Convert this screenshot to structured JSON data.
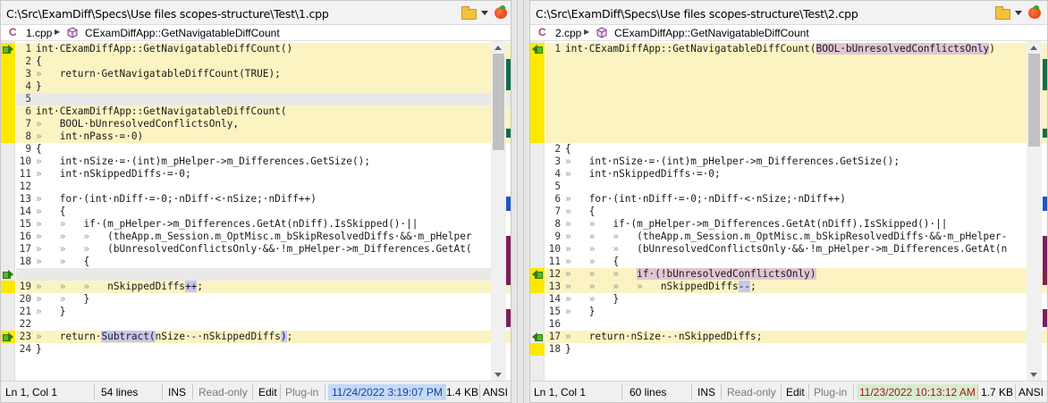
{
  "colors": {
    "changed_line_bg": "#fbf3c2",
    "deleted_gap_bg": "#e9e9e9",
    "added_token_bg": "#c9c9f2",
    "changed_token_bg": "#e4c6d6",
    "change_marker_yellow": "#ffe800",
    "nav_arrow_green": "#58b72e",
    "date_left_bg": "#c3d9f7",
    "date_right_bg": "#d8eccf",
    "date_right_text": "#a01818"
  },
  "left": {
    "path": "C:\\Src\\ExamDiff\\Specs\\Use files scopes-structure\\Test\\1.cpp",
    "breadcrumb": {
      "lang_icon": "C",
      "file": "1.cpp",
      "sep": "▶",
      "function": "CExamDiffApp::GetNavigatableDiffCount"
    },
    "lines": [
      {
        "n": "1",
        "bg": "#fbf3c2",
        "arrow": "right",
        "segs": [
          {
            "t": "int·CExamDiffApp::GetNavigatableDiffCount()"
          }
        ]
      },
      {
        "n": "2",
        "bg": "#fbf3c2",
        "segs": [
          {
            "t": "{"
          }
        ]
      },
      {
        "n": "3",
        "bg": "#fbf3c2",
        "segs": [
          {
            "t": "»   ",
            "c": "ws"
          },
          {
            "t": "return·GetNavigatableDiffCount(TRUE);"
          }
        ]
      },
      {
        "n": "4",
        "bg": "#fbf3c2",
        "segs": [
          {
            "t": "}"
          }
        ]
      },
      {
        "n": "5",
        "bg": "#e9e9e9",
        "segs": [
          {
            "t": ""
          }
        ]
      },
      {
        "n": "6",
        "bg": "#fbf3c2",
        "segs": [
          {
            "t": "int·CExamDiffApp::GetNavigatableDiffCount("
          }
        ]
      },
      {
        "n": "7",
        "bg": "#fbf3c2",
        "segs": [
          {
            "t": "»   ",
            "c": "ws"
          },
          {
            "t": "BOOL·bUnresolvedConflictsOnly,"
          }
        ]
      },
      {
        "n": "8",
        "bg": "#fbf3c2",
        "segs": [
          {
            "t": "»   ",
            "c": "ws"
          },
          {
            "t": "int·nPass·=·0)"
          }
        ]
      },
      {
        "n": "9",
        "bg": "#ffffff",
        "segs": [
          {
            "t": "{"
          }
        ]
      },
      {
        "n": "10",
        "bg": "#ffffff",
        "segs": [
          {
            "t": "»   ",
            "c": "ws"
          },
          {
            "t": "int·nSize·=·(int)m_pHelper->m_Differences.GetSize();"
          }
        ]
      },
      {
        "n": "11",
        "bg": "#ffffff",
        "segs": [
          {
            "t": "»   ",
            "c": "ws"
          },
          {
            "t": "int·nSkippedDiffs·=·0;"
          }
        ]
      },
      {
        "n": "12",
        "bg": "#ffffff",
        "segs": [
          {
            "t": ""
          }
        ]
      },
      {
        "n": "13",
        "bg": "#ffffff",
        "segs": [
          {
            "t": "»   ",
            "c": "ws"
          },
          {
            "t": "for·(int·nDiff·=·0;·nDiff·<·nSize;·nDiff++)"
          }
        ]
      },
      {
        "n": "14",
        "bg": "#ffffff",
        "segs": [
          {
            "t": "»   ",
            "c": "ws"
          },
          {
            "t": "{"
          }
        ]
      },
      {
        "n": "15",
        "bg": "#ffffff",
        "segs": [
          {
            "t": "»   »   ",
            "c": "ws"
          },
          {
            "t": "if·(m_pHelper->m_Differences.GetAt(nDiff).IsSkipped()·||"
          }
        ]
      },
      {
        "n": "16",
        "bg": "#ffffff",
        "segs": [
          {
            "t": "»   »   »   ",
            "c": "ws"
          },
          {
            "t": "(theApp.m_Session.m_OptMisc.m_bSkipResolvedDiffs·&&·m_pHelper"
          }
        ]
      },
      {
        "n": "17",
        "bg": "#ffffff",
        "segs": [
          {
            "t": "»   »   »   ",
            "c": "ws"
          },
          {
            "t": "(bUnresolvedConflictsOnly·&&·!m_pHelper->m_Differences.GetAt("
          }
        ]
      },
      {
        "n": "18",
        "bg": "#ffffff",
        "segs": [
          {
            "t": "»   »   ",
            "c": "ws"
          },
          {
            "t": "{"
          }
        ]
      },
      {
        "n": "",
        "bg": "#e9e9e9",
        "arrow": "right",
        "segs": [
          {
            "t": ""
          }
        ]
      },
      {
        "n": "19",
        "bg": "#fbf3c2",
        "segs": [
          {
            "t": "»   »   »   ",
            "c": "ws"
          },
          {
            "t": "nSkippedDiffs"
          },
          {
            "t": "++",
            "c": "add"
          },
          {
            "t": ";"
          }
        ]
      },
      {
        "n": "20",
        "bg": "#ffffff",
        "segs": [
          {
            "t": "»   »   ",
            "c": "ws"
          },
          {
            "t": "}"
          }
        ]
      },
      {
        "n": "21",
        "bg": "#ffffff",
        "segs": [
          {
            "t": "»   ",
            "c": "ws"
          },
          {
            "t": "}"
          }
        ]
      },
      {
        "n": "22",
        "bg": "#ffffff",
        "segs": [
          {
            "t": ""
          }
        ]
      },
      {
        "n": "23",
        "bg": "#fbf3c2",
        "arrow": "right",
        "segs": [
          {
            "t": "»   ",
            "c": "ws"
          },
          {
            "t": "return·"
          },
          {
            "t": "Subtract(",
            "c": "add"
          },
          {
            "t": "nSize·-·nSkippedDiffs"
          },
          {
            "t": ")",
            "c": "add"
          },
          {
            "t": ";"
          }
        ]
      },
      {
        "n": "24",
        "bg": "#ffffff",
        "segs": [
          {
            "t": "}"
          }
        ]
      }
    ],
    "status": {
      "pos": "Ln 1, Col 1",
      "lines": "54 lines",
      "ins": "INS",
      "readonly": "Read-only",
      "edit": "Edit",
      "plugin": "Plug-in",
      "date": "11/24/2022 3:19:07 PM",
      "size": "1.4 KB",
      "enc": "ANSI"
    }
  },
  "right": {
    "path": "C:\\Src\\ExamDiff\\Specs\\Use files scopes-structure\\Test\\2.cpp",
    "breadcrumb": {
      "lang_icon": "C",
      "file": "2.cpp",
      "sep": "▶",
      "function": "CExamDiffApp::GetNavigatableDiffCount"
    },
    "lines": [
      {
        "n": "1",
        "bg": "#fbf3c2",
        "arrow": "left",
        "segs": [
          {
            "t": "int·CExamDiffApp::GetNavigatableDiffCount("
          },
          {
            "t": "BOOL·bUnresolvedConflictsOnly",
            "c": "chg"
          },
          {
            "t": ")"
          }
        ]
      },
      {
        "n": "",
        "bg": "#fbf3c2",
        "segs": [
          {
            "t": ""
          }
        ]
      },
      {
        "n": "",
        "bg": "#fbf3c2",
        "segs": [
          {
            "t": ""
          }
        ]
      },
      {
        "n": "",
        "bg": "#fbf3c2",
        "segs": [
          {
            "t": ""
          }
        ]
      },
      {
        "n": "",
        "bg": "#fbf3c2",
        "segs": [
          {
            "t": ""
          }
        ]
      },
      {
        "n": "",
        "bg": "#fbf3c2",
        "segs": [
          {
            "t": ""
          }
        ]
      },
      {
        "n": "",
        "bg": "#fbf3c2",
        "segs": [
          {
            "t": ""
          }
        ]
      },
      {
        "n": "",
        "bg": "#fbf3c2",
        "segs": [
          {
            "t": ""
          }
        ]
      },
      {
        "n": "2",
        "bg": "#ffffff",
        "segs": [
          {
            "t": "{"
          }
        ]
      },
      {
        "n": "3",
        "bg": "#ffffff",
        "segs": [
          {
            "t": "»   ",
            "c": "ws"
          },
          {
            "t": "int·nSize·=·(int)m_pHelper->m_Differences.GetSize();"
          }
        ]
      },
      {
        "n": "4",
        "bg": "#ffffff",
        "segs": [
          {
            "t": "»   ",
            "c": "ws"
          },
          {
            "t": "int·nSkippedDiffs·=·0;"
          }
        ]
      },
      {
        "n": "5",
        "bg": "#ffffff",
        "segs": [
          {
            "t": ""
          }
        ]
      },
      {
        "n": "6",
        "bg": "#ffffff",
        "segs": [
          {
            "t": "»   ",
            "c": "ws"
          },
          {
            "t": "for·(int·nDiff·=·0;·nDiff·<·nSize;·nDiff++)"
          }
        ]
      },
      {
        "n": "7",
        "bg": "#ffffff",
        "segs": [
          {
            "t": "»   ",
            "c": "ws"
          },
          {
            "t": "{"
          }
        ]
      },
      {
        "n": "8",
        "bg": "#ffffff",
        "segs": [
          {
            "t": "»   »   ",
            "c": "ws"
          },
          {
            "t": "if·(m_pHelper->m_Differences.GetAt(nDiff).IsSkipped()·||"
          }
        ]
      },
      {
        "n": "9",
        "bg": "#ffffff",
        "segs": [
          {
            "t": "»   »   »   ",
            "c": "ws"
          },
          {
            "t": "(theApp.m_Session.m_OptMisc.m_bSkipResolvedDiffs·&&·m_pHelper-"
          }
        ]
      },
      {
        "n": "10",
        "bg": "#ffffff",
        "segs": [
          {
            "t": "»   »   »   ",
            "c": "ws"
          },
          {
            "t": "(bUnresolvedConflictsOnly·&&·!m_pHelper->m_Differences.GetAt(n"
          }
        ]
      },
      {
        "n": "11",
        "bg": "#ffffff",
        "segs": [
          {
            "t": "»   »   ",
            "c": "ws"
          },
          {
            "t": "{"
          }
        ]
      },
      {
        "n": "12",
        "bg": "#fbf3c2",
        "arrow": "left",
        "segs": [
          {
            "t": "»   »   »   ",
            "c": "ws"
          },
          {
            "t": "if·(!bUnresolvedConflictsOnly)",
            "c": "chg"
          }
        ]
      },
      {
        "n": "13",
        "bg": "#fbf3c2",
        "segs": [
          {
            "t": "»   »   »   »   ",
            "c": "ws"
          },
          {
            "t": "nSkippedDiffs"
          },
          {
            "t": "--",
            "c": "add"
          },
          {
            "t": ";"
          }
        ]
      },
      {
        "n": "14",
        "bg": "#ffffff",
        "segs": [
          {
            "t": "»   »   ",
            "c": "ws"
          },
          {
            "t": "}"
          }
        ]
      },
      {
        "n": "15",
        "bg": "#ffffff",
        "segs": [
          {
            "t": "»   ",
            "c": "ws"
          },
          {
            "t": "}"
          }
        ]
      },
      {
        "n": "16",
        "bg": "#ffffff",
        "segs": [
          {
            "t": ""
          }
        ]
      },
      {
        "n": "17",
        "bg": "#fbf3c2",
        "arrow": "left",
        "segs": [
          {
            "t": "»   ",
            "c": "ws"
          },
          {
            "t": "return·nSize·-·nSkippedDiffs;"
          }
        ]
      },
      {
        "n": "18",
        "bg": "#ffffff",
        "segs": [
          {
            "t": "}"
          }
        ]
      }
    ],
    "status": {
      "pos": "Ln 1, Col 1",
      "lines": "60 lines",
      "ins": "INS",
      "readonly": "Read-only",
      "edit": "Edit",
      "plugin": "Plug-in",
      "date": "11/23/2022 10:13:12 AM",
      "size": "1.7 KB",
      "enc": "ANSI"
    }
  }
}
